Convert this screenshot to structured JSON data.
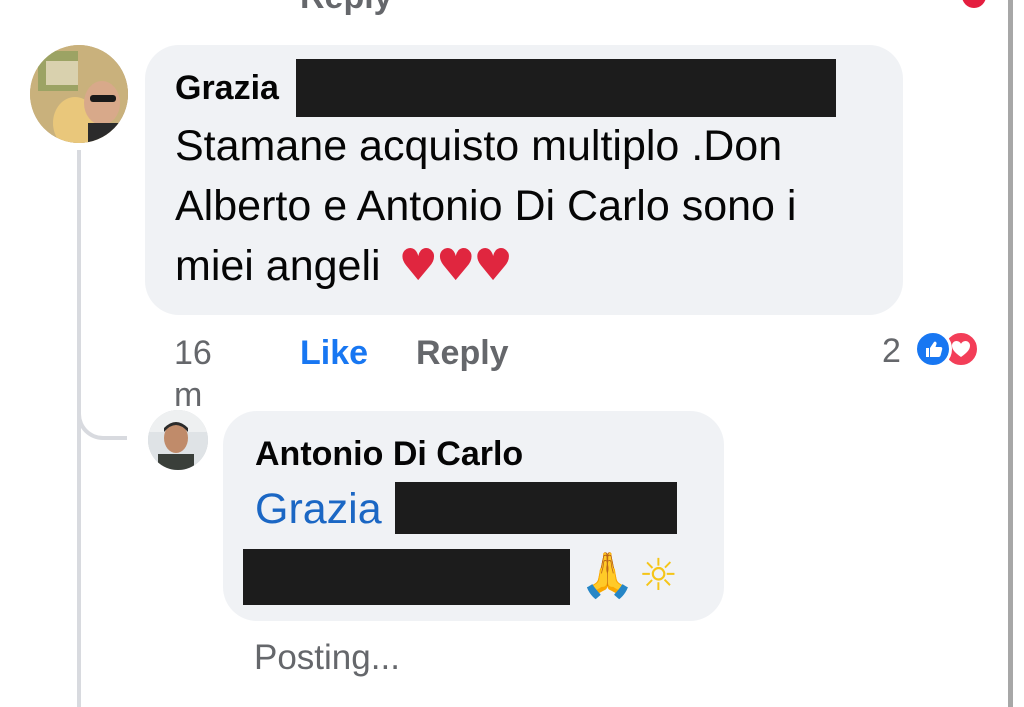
{
  "top_partial": {
    "text": "Reply"
  },
  "comment": {
    "author": "Grazia",
    "text_lines": [
      "Stamane  acquisto multiplo .Don",
      "Alberto e Antonio Di Carlo sono i",
      "miei angeli"
    ],
    "emoji": "♥♥♥",
    "time": "16 m",
    "like_label": "Like",
    "reply_label": "Reply",
    "reaction_count": "2",
    "reaction_icons": [
      "like-icon",
      "love-icon"
    ]
  },
  "reply": {
    "author": "Antonio Di Carlo",
    "mention": "Grazia",
    "emoji_pray": "🙏",
    "emoji_sun": "☼",
    "status": "Posting..."
  },
  "colors": {
    "bubble": "#f0f2f5",
    "link_blue": "#1877f2",
    "mention_blue": "#1b67c4",
    "meta_gray": "#65676b",
    "heart_red": "#e0263f",
    "redaction": "#1c1c1c"
  }
}
